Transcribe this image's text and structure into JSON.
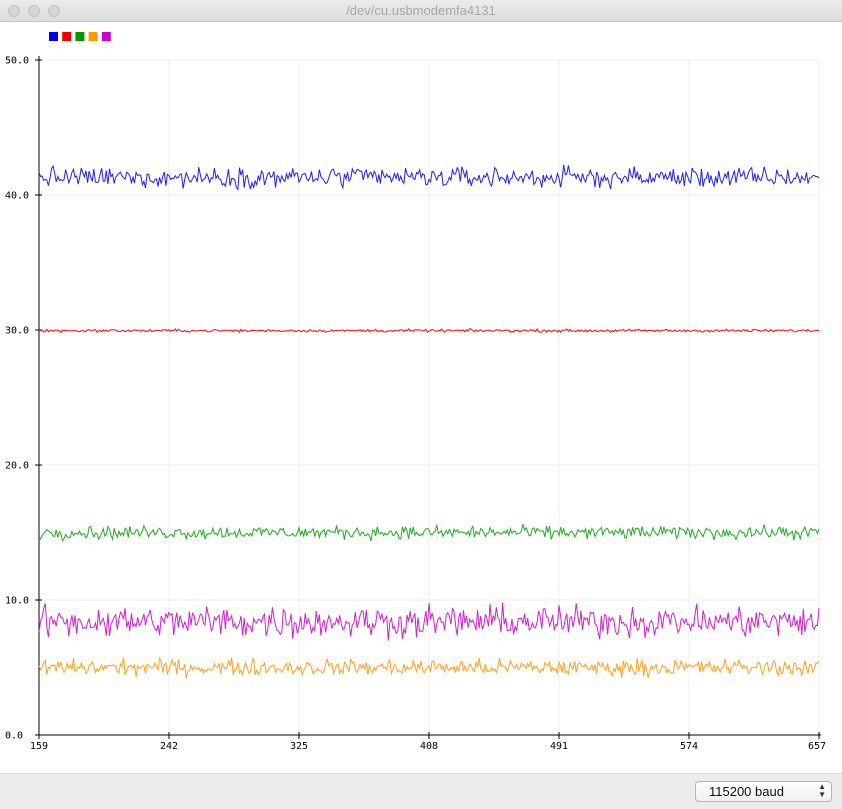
{
  "window": {
    "title": "/dev/cu.usbmodemfa4131"
  },
  "legend": {
    "swatches": [
      {
        "color": "#0000ee"
      },
      {
        "color": "#ee0000"
      },
      {
        "color": "#009900"
      },
      {
        "color": "#ff9900"
      },
      {
        "color": "#cc00cc"
      }
    ]
  },
  "footer": {
    "baud_label": "115200 baud"
  },
  "chart_data": {
    "type": "line",
    "title": "",
    "xlabel": "",
    "ylabel": "",
    "xlim": [
      159,
      657
    ],
    "ylim": [
      0,
      50
    ],
    "x_ticks": [
      "159",
      "242",
      "325",
      "408",
      "491",
      "574",
      "657"
    ],
    "y_ticks": [
      "0.0",
      "10.0",
      "20.0",
      "30.0",
      "40.0",
      "50.0"
    ],
    "grid": true,
    "legend_position": "top-left",
    "series": [
      {
        "color": "#2020ee",
        "mean": 41.3,
        "noise": 0.55
      },
      {
        "color": "#ee1111",
        "mean": 29.95,
        "noise": 0.08
      },
      {
        "color": "#22aa22",
        "mean": 15.0,
        "noise": 0.35
      },
      {
        "color": "#ffa020",
        "mean": 5.0,
        "noise": 0.45
      },
      {
        "color": "#cc22cc",
        "mean": 8.4,
        "noise": 0.85
      }
    ]
  }
}
